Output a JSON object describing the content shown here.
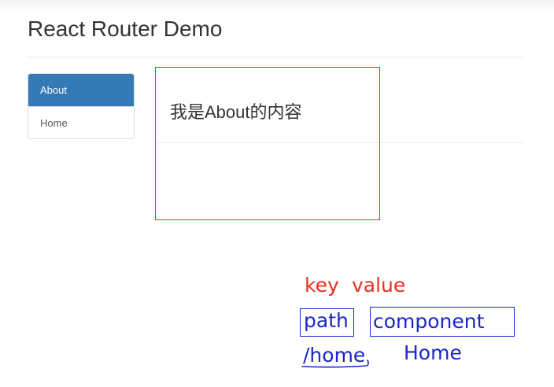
{
  "header": {
    "title": "React Router Demo"
  },
  "nav": {
    "items": [
      {
        "label": "About",
        "active": true
      },
      {
        "label": "Home",
        "active": false
      }
    ],
    "active_color": "#337ab7"
  },
  "content": {
    "text": "我是About的内容"
  },
  "annotations": {
    "key_label": "key",
    "value_label": "value",
    "path_label": "path",
    "component_label": "component",
    "path_example": "/home",
    "component_example": "Home",
    "red_color": "#e8301c",
    "blue_color": "#1a26c9"
  }
}
